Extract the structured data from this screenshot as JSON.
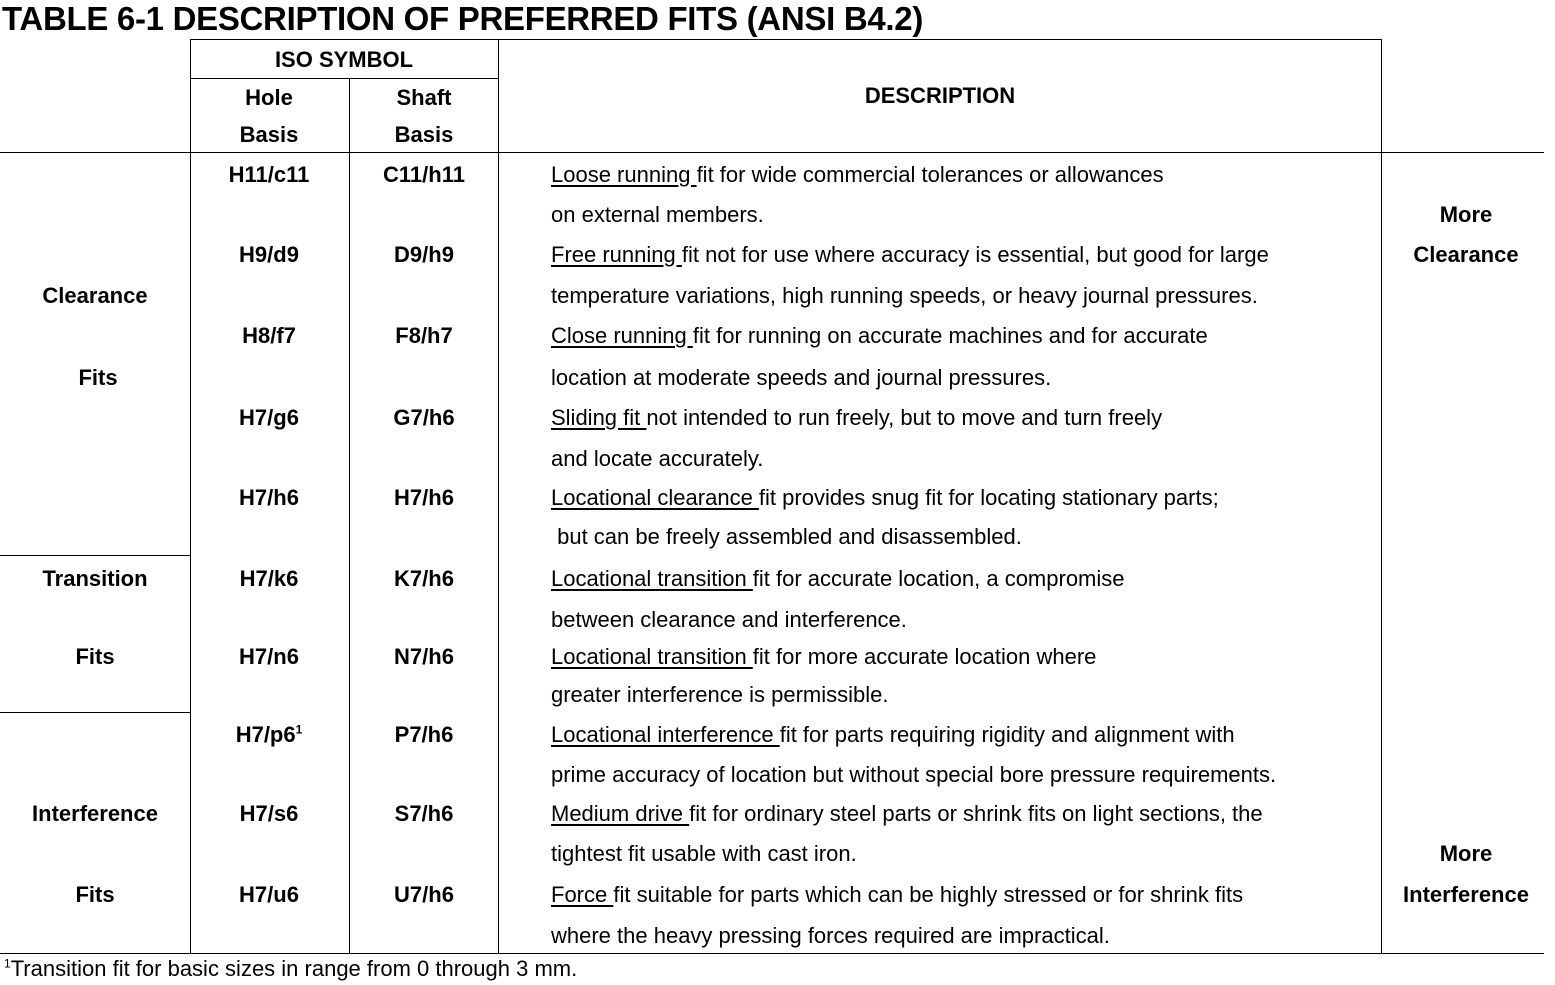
{
  "title": "TABLE 6-1 DESCRIPTION OF PREFERRED FITS (ANSI B4.2)",
  "header": {
    "iso_symbol": "ISO SYMBOL",
    "hole_basis": [
      "Hole",
      "Basis"
    ],
    "shaft_basis": [
      "Shaft",
      "Basis"
    ],
    "description": "DESCRIPTION"
  },
  "groups": {
    "clearance": [
      "Clearance",
      "Fits"
    ],
    "transition": [
      "Transition",
      "Fits"
    ],
    "interference": [
      "Interference",
      "Fits"
    ]
  },
  "side_labels": {
    "more_clearance": [
      "More",
      "Clearance"
    ],
    "more_interference": [
      "More",
      "Interference"
    ]
  },
  "rows": [
    {
      "hole": "H11/c11",
      "hole_sup": "",
      "shaft": "C11/h11",
      "term": "Loose running ",
      "rest1": "fit for wide commercial tolerances or allowances",
      "line2": "on external members."
    },
    {
      "hole": "H9/d9",
      "hole_sup": "",
      "shaft": "D9/h9",
      "term": "Free running ",
      "rest1": "fit not for use where accuracy is essential, but good for large",
      "line2": "temperature variations, high running speeds, or heavy journal pressures."
    },
    {
      "hole": "H8/f7",
      "hole_sup": "",
      "shaft": "F8/h7",
      "term": "Close running ",
      "rest1": "fit for running on accurate machines and for accurate",
      "line2": "location at moderate speeds and journal pressures."
    },
    {
      "hole": "H7/g6",
      "hole_sup": "",
      "shaft": "G7/h6",
      "term": "Sliding fit ",
      "rest1": "not intended to run freely, but to move and turn freely",
      "line2": "and locate accurately."
    },
    {
      "hole": "H7/h6",
      "hole_sup": "",
      "shaft": "H7/h6",
      "term": "Locational clearance ",
      "rest1": "fit provides snug fit for locating stationary parts;",
      "line2": " but can be freely assembled and disassembled."
    },
    {
      "hole": "H7/k6",
      "hole_sup": "",
      "shaft": "K7/h6",
      "term": "Locational transition ",
      "rest1": "fit for accurate location, a compromise",
      "line2": "between clearance and interference."
    },
    {
      "hole": "H7/n6",
      "hole_sup": "",
      "shaft": "N7/h6",
      "term": "Locational transition ",
      "rest1": "fit for more accurate location where",
      "line2": "greater interference is permissible."
    },
    {
      "hole": "H7/p6",
      "hole_sup": "1",
      "shaft": "P7/h6",
      "term": "Locational interference ",
      "rest1": "fit for parts requiring rigidity and alignment with",
      "line2": "prime accuracy of location but without special bore pressure requirements."
    },
    {
      "hole": "H7/s6",
      "hole_sup": "",
      "shaft": "S7/h6",
      "term": "Medium drive ",
      "rest1": "fit for ordinary steel parts or shrink fits on light sections, the",
      "line2": "tightest fit usable with cast iron."
    },
    {
      "hole": "H7/u6",
      "hole_sup": "",
      "shaft": "U7/h6",
      "term": "Force ",
      "rest1": "fit suitable for parts which can be highly stressed or for shrink fits",
      "line2": "where the heavy pressing forces required are impractical."
    }
  ],
  "footnote": {
    "mark": "1",
    "text": "Transition fit for basic sizes in range from 0 through 3 mm."
  }
}
